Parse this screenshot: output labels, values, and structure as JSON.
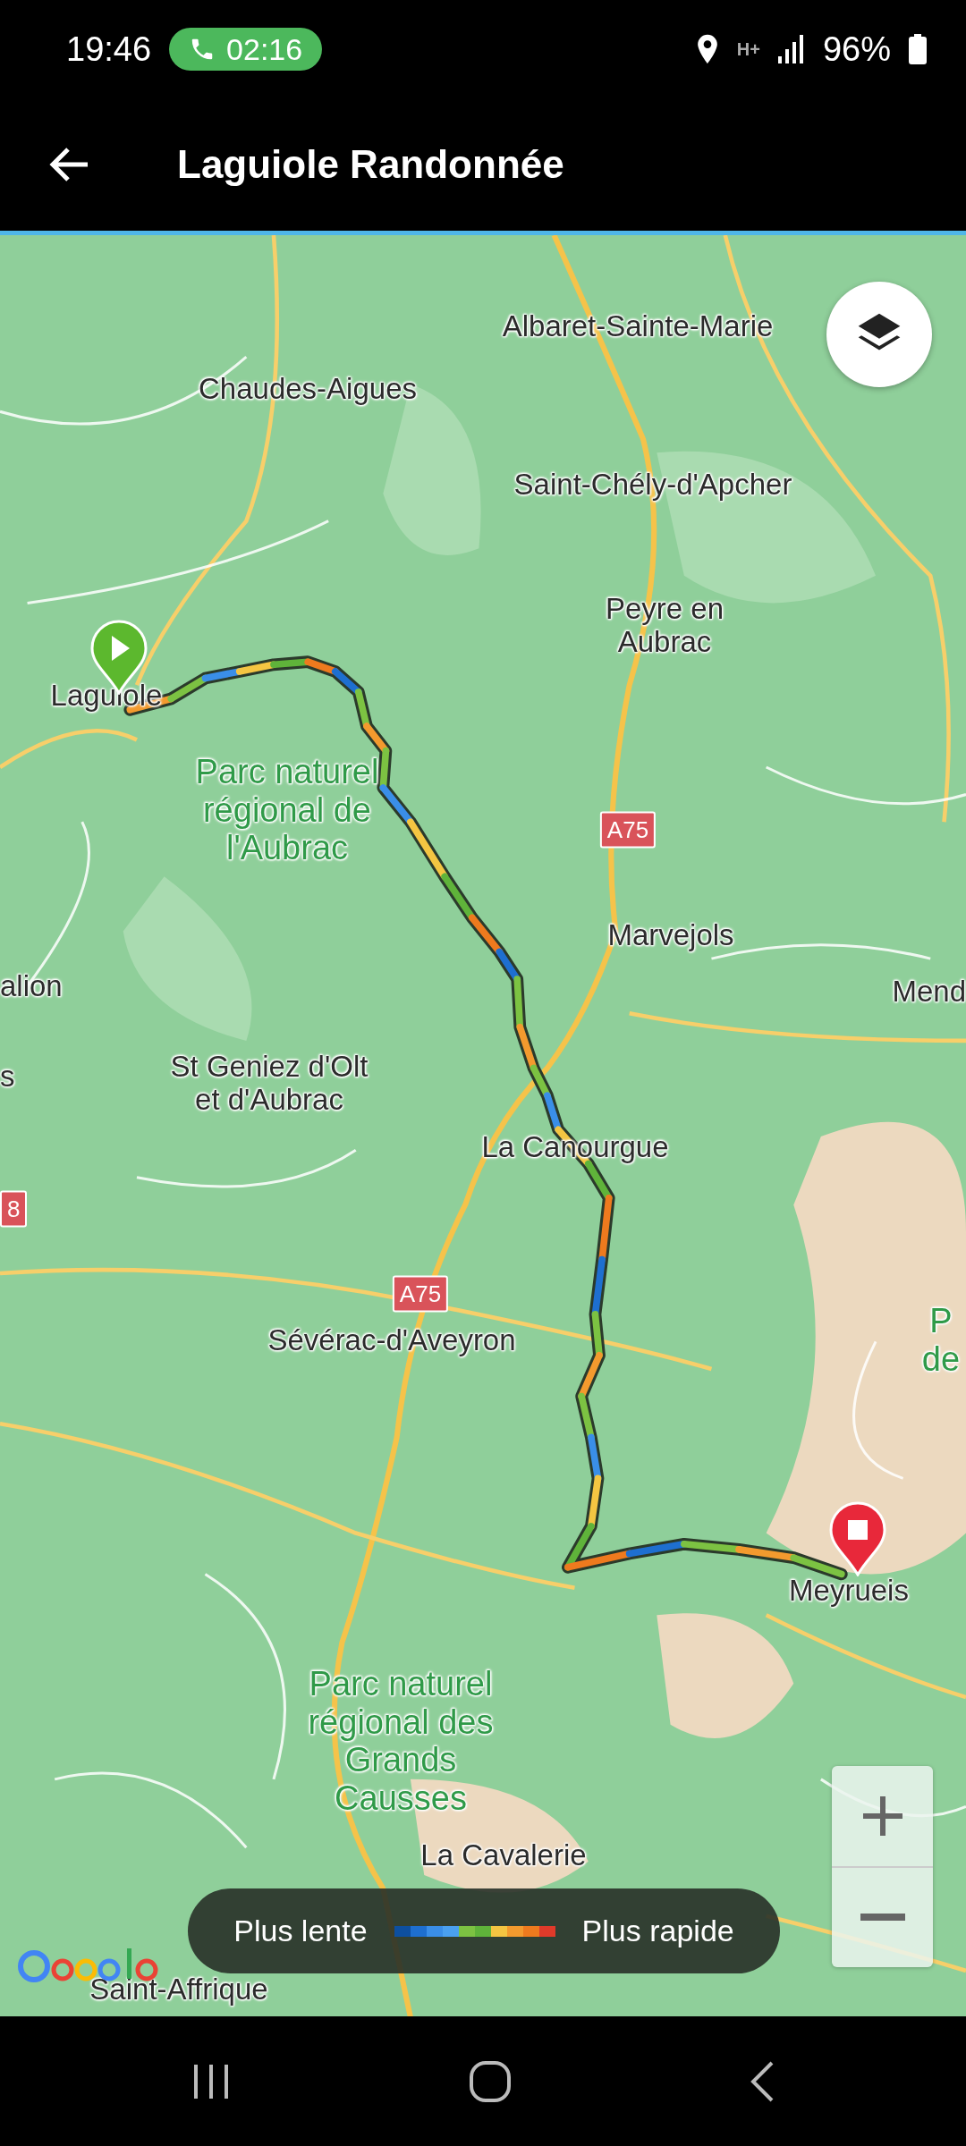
{
  "status_bar": {
    "time": "19:46",
    "call_timer": "02:16",
    "network_type": "H+",
    "battery": "96%"
  },
  "header": {
    "title": "Laguiole Randonnée"
  },
  "map": {
    "labels": [
      {
        "text": "Albaret-Sainte-Marie",
        "kind": "place"
      },
      {
        "text": "Chaudes-Aigues",
        "kind": "place"
      },
      {
        "text": "Saint-Chély-d'Apcher",
        "kind": "place"
      },
      {
        "text": "Peyre en Aubrac",
        "kind": "place"
      },
      {
        "text": "Laguiole",
        "kind": "place"
      },
      {
        "text": "Parc naturel régional de l'Aubrac",
        "kind": "park"
      },
      {
        "text": "A75",
        "kind": "road"
      },
      {
        "text": "Marvejols",
        "kind": "place"
      },
      {
        "text": "alion",
        "kind": "place"
      },
      {
        "text": "Mend",
        "kind": "place"
      },
      {
        "text": "s",
        "kind": "place"
      },
      {
        "text": "St Geniez d'Olt et d'Aubrac",
        "kind": "place"
      },
      {
        "text": "8",
        "kind": "road"
      },
      {
        "text": "La Canourgue",
        "kind": "place"
      },
      {
        "text": "A75",
        "kind": "road"
      },
      {
        "text": "Sévérac-d'Aveyron",
        "kind": "place"
      },
      {
        "text": "P de",
        "kind": "park"
      },
      {
        "text": "Meyrueis",
        "kind": "place"
      },
      {
        "text": "Parc naturel régional des Grands Causses",
        "kind": "park"
      },
      {
        "text": "La Cavalerie",
        "kind": "place"
      },
      {
        "text": "Saint-Affrique",
        "kind": "place"
      }
    ],
    "legend": {
      "slow_label": "Plus lente",
      "fast_label": "Plus rapide"
    }
  }
}
